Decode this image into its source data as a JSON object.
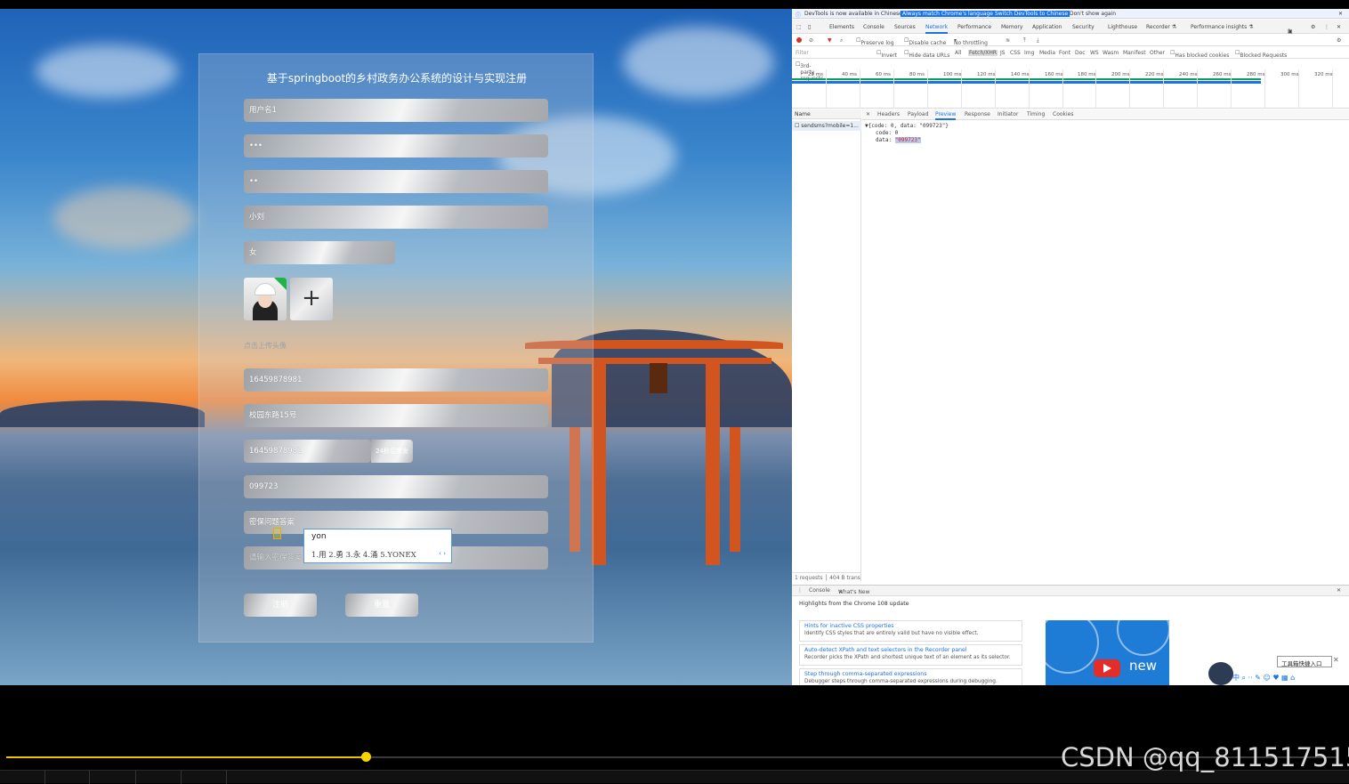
{
  "form": {
    "title": "基于springboot的乡村政务办公系统的设计与实现注册",
    "username": "用户名1",
    "password": "•••",
    "confirm_password": "••",
    "name": "小刘",
    "gender": "女",
    "upload_hint": "点击上传头像",
    "phone": "16459878981",
    "address": "校园东路15号",
    "sms_phone": "16459878981",
    "resend_label": "24秒后重发",
    "code": "099723",
    "security_answer_value": "密保问题答案",
    "security_answer_placeholder": "请输入密保答案",
    "register_label": "注册",
    "reset_label": "重置"
  },
  "ime": {
    "composition": "yon",
    "candidates": "1.用  2.勇  3.永  4.涌  5.YONEX",
    "arrows": "‹ ›"
  },
  "devtools": {
    "info": {
      "message": "DevTools is now available in Chinese!",
      "match_btn": "Always match Chrome's language",
      "switch_btn": "Switch DevTools to Chinese",
      "dismiss": "Don't show again"
    },
    "tabs": [
      "Elements",
      "Console",
      "Sources",
      "Network",
      "Performance",
      "Memory",
      "Application",
      "Security",
      "Lighthouse",
      "Recorder ⚗",
      "Performance insights ⚗"
    ],
    "badge": "1",
    "toolbar": {
      "preserve_log": "Preserve log",
      "disable_cache": "Disable cache",
      "throttling": "No throttling"
    },
    "filter": {
      "placeholder": "Filter",
      "invert": "Invert",
      "hide_data_urls": "Hide data URLs",
      "types": [
        "All",
        "Fetch/XHR",
        "JS",
        "CSS",
        "Img",
        "Media",
        "Font",
        "Doc",
        "WS",
        "Wasm",
        "Manifest",
        "Other"
      ],
      "has_blocked_cookies": "Has blocked cookies",
      "blocked_requests": "Blocked Requests",
      "third_party": "3rd-party requests"
    },
    "timeline_ticks": [
      "20 ms",
      "40 ms",
      "60 ms",
      "80 ms",
      "100 ms",
      "120 ms",
      "140 ms",
      "160 ms",
      "180 ms",
      "200 ms",
      "220 ms",
      "240 ms",
      "260 ms",
      "280 ms",
      "300 ms",
      "320 ms"
    ],
    "requests": {
      "header": "Name",
      "item": "sendsms?mobile=1...",
      "footer": "1 requests",
      "transferred": "404 B trans"
    },
    "detail_tabs": [
      "Headers",
      "Payload",
      "Preview",
      "Response",
      "Initiator",
      "Timing",
      "Cookies"
    ],
    "preview": {
      "line1": "▼{code: 0, data: \"099723\"}",
      "line2": "code: 0",
      "line3_key": "data: ",
      "line3_val": "\"099723\""
    },
    "drawer": {
      "tabs": [
        "Console",
        "What's New"
      ],
      "headline": "Highlights from the Chrome 108 update",
      "cards": [
        {
          "title": "Hints for inactive CSS properties",
          "desc": "Identify CSS styles that are entirely valid but have no visible effect."
        },
        {
          "title": "Auto-detect XPath and text selectors in the Recorder panel",
          "desc": "Recorder picks the XPath and shortest unique text of an element as its selector."
        },
        {
          "title": "Step through comma-separated expressions",
          "desc": "Debugger steps through comma-separated expressions during debugging."
        }
      ],
      "video_word": "new"
    },
    "toolbox": "工具箱快捷入口",
    "ime_toolbar": "中 ⌕ ·· ✎ ☺ ♥ ▦ ⌂"
  },
  "player": {
    "progress": 0.27
  },
  "watermark": "CSDN @qq_811517515"
}
